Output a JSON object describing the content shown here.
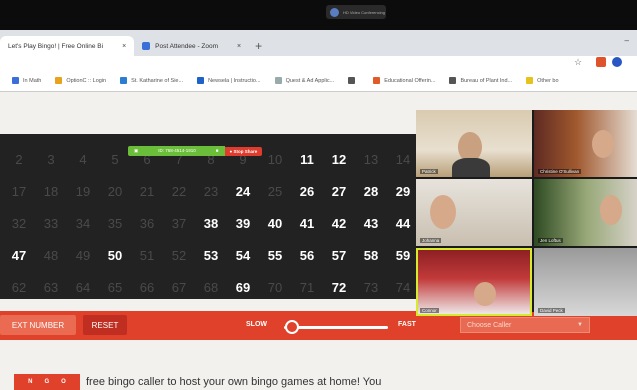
{
  "zoom_bar": {
    "label": "HD Video Conferencing"
  },
  "tabs": [
    {
      "title": "Let's Play Bingo! | Free Online Bi",
      "close": "×"
    },
    {
      "title": "Post Attendee - Zoom",
      "close": "×"
    }
  ],
  "new_tab": "+",
  "window_minimize": "–",
  "bookmarks": [
    {
      "label": "In Math",
      "color": "#3a6fd8"
    },
    {
      "label": "OptionC :: Login",
      "color": "#e8a21c"
    },
    {
      "label": "St. Katharine of Sie...",
      "color": "#2a7dd0"
    },
    {
      "label": "Newsela | Instructio...",
      "color": "#1f62c7"
    },
    {
      "label": "Quest & Ad Applic...",
      "color": "#9aa"
    },
    {
      "label": "",
      "color": "#555"
    },
    {
      "label": "Educational Offerin...",
      "color": "#e05a2a"
    },
    {
      "label": "Bureau of Plant Ind...",
      "color": "#555"
    },
    {
      "label": "Other bo",
      "color": "#e8c21c"
    }
  ],
  "board": {
    "numbers_rows": [
      [
        2,
        3,
        4,
        5,
        6,
        7,
        8,
        9,
        10,
        11,
        12,
        13,
        14
      ],
      [
        17,
        18,
        19,
        20,
        21,
        22,
        23,
        24,
        25,
        26,
        27,
        28,
        29
      ],
      [
        32,
        33,
        34,
        35,
        36,
        37,
        38,
        39,
        40,
        41,
        42,
        43,
        44
      ],
      [
        47,
        48,
        49,
        50,
        51,
        52,
        53,
        54,
        55,
        56,
        57,
        58,
        59
      ],
      [
        62,
        63,
        64,
        65,
        66,
        67,
        68,
        69,
        70,
        71,
        72,
        73,
        74
      ]
    ],
    "called": [
      11,
      12,
      24,
      26,
      27,
      28,
      29,
      38,
      39,
      40,
      41,
      42,
      43,
      44,
      47,
      50,
      53,
      54,
      55,
      56,
      57,
      58,
      59,
      69,
      72
    ]
  },
  "share_bar": {
    "meeting_id": "ID: 768-4514-1910",
    "stop_label": "Stop Share"
  },
  "controls": {
    "next_label": "EXT NUMBER",
    "reset_label": "RESET",
    "slow_label": "SLOW",
    "fast_label": "FAST",
    "caller_placeholder": "Choose Caller",
    "speed_level": 0.05
  },
  "bingo_badge": [
    "N",
    "G",
    "O"
  ],
  "intro_text": "free bingo caller to host your own bingo games at home! You",
  "participants": [
    {
      "name": "Patrick"
    },
    {
      "name": "Christine O'Sullivan"
    },
    {
      "name": "Johanna"
    },
    {
      "name": "Jen Loftus"
    },
    {
      "name": "Connor"
    },
    {
      "name": "David Peck"
    }
  ],
  "colors": {
    "brand_red": "#e0412a",
    "speaker_outline": "#d6ea2e"
  }
}
